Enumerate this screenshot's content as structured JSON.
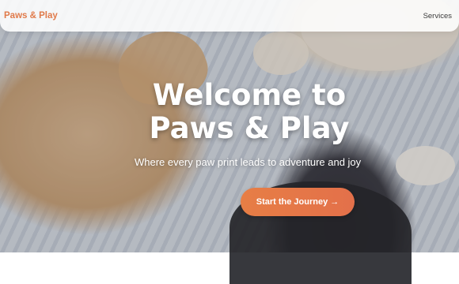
{
  "navbar": {
    "brand": "Paws & Play",
    "links": [
      "Services"
    ]
  },
  "hero": {
    "title": "Welcome to Paws & Play",
    "subtitle": "Where every paw print leads to adventure and joy",
    "cta_label": "Start the Journey →"
  },
  "colors": {
    "accent": "#e07a4a",
    "cta": "#e77e45",
    "text_light": "#ffffff"
  }
}
